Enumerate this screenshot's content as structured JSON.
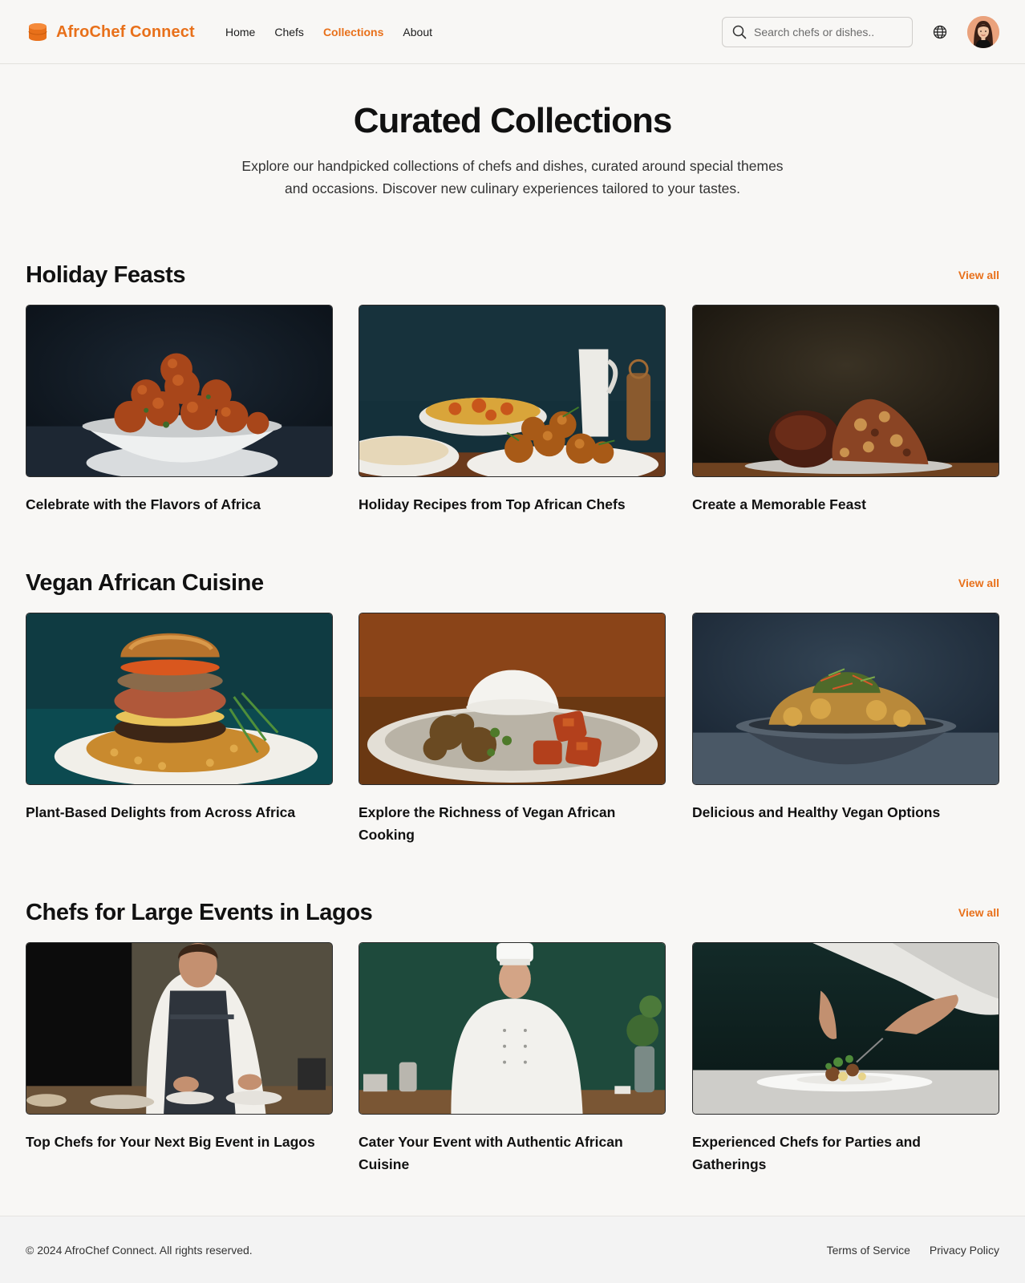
{
  "brand": {
    "name": "AfroChef Connect",
    "color": "#e8701a"
  },
  "nav": {
    "items": [
      {
        "label": "Home",
        "active": false
      },
      {
        "label": "Chefs",
        "active": false
      },
      {
        "label": "Collections",
        "active": true
      },
      {
        "label": "About",
        "active": false
      }
    ]
  },
  "search": {
    "placeholder": "Search chefs or dishes..",
    "value": ""
  },
  "icons": {
    "search": "search-icon",
    "language": "globe-icon",
    "user": "avatar"
  },
  "hero": {
    "title": "Curated Collections",
    "subtitle": "Explore our handpicked collections of chefs and dishes, curated around special themes and occasions. Discover new culinary experiences tailored to your tastes."
  },
  "sections": [
    {
      "title": "Holiday Feasts",
      "view_all": "View all",
      "cards": [
        {
          "title": "Celebrate with the Flavors of Africa",
          "image": "bowl of glazed meatballs on dark background"
        },
        {
          "title": "Holiday Recipes from Top African Chefs",
          "image": "table spread with rice, stew and pitcher"
        },
        {
          "title": "Create a Memorable Feast",
          "image": "roasted meat pieces on plate"
        }
      ]
    },
    {
      "title": "Vegan African Cuisine",
      "view_all": "View all",
      "cards": [
        {
          "title": "Plant-Based Delights from Across Africa",
          "image": "stacked veggie burger with grains"
        },
        {
          "title": "Explore the Richness of Vegan African Cooking",
          "image": "rice dome with stew in bowl"
        },
        {
          "title": "Delicious and Healthy Vegan Options",
          "image": "curry stew in gray bowl"
        }
      ]
    },
    {
      "title": "Chefs for Large Events in Lagos",
      "view_all": "View all",
      "cards": [
        {
          "title": "Top Chefs for Your Next Big Event in Lagos",
          "image": "chef in apron plating dishes"
        },
        {
          "title": "Cater Your Event with Authentic African Cuisine",
          "image": "chef in white coat in green kitchen"
        },
        {
          "title": "Experienced Chefs for Parties and Gatherings",
          "image": "hands garnishing plated dish"
        }
      ]
    }
  ],
  "footer": {
    "copyright": "© 2024 AfroChef Connect. All rights reserved.",
    "links": [
      "Terms of Service",
      "Privacy Policy"
    ]
  }
}
